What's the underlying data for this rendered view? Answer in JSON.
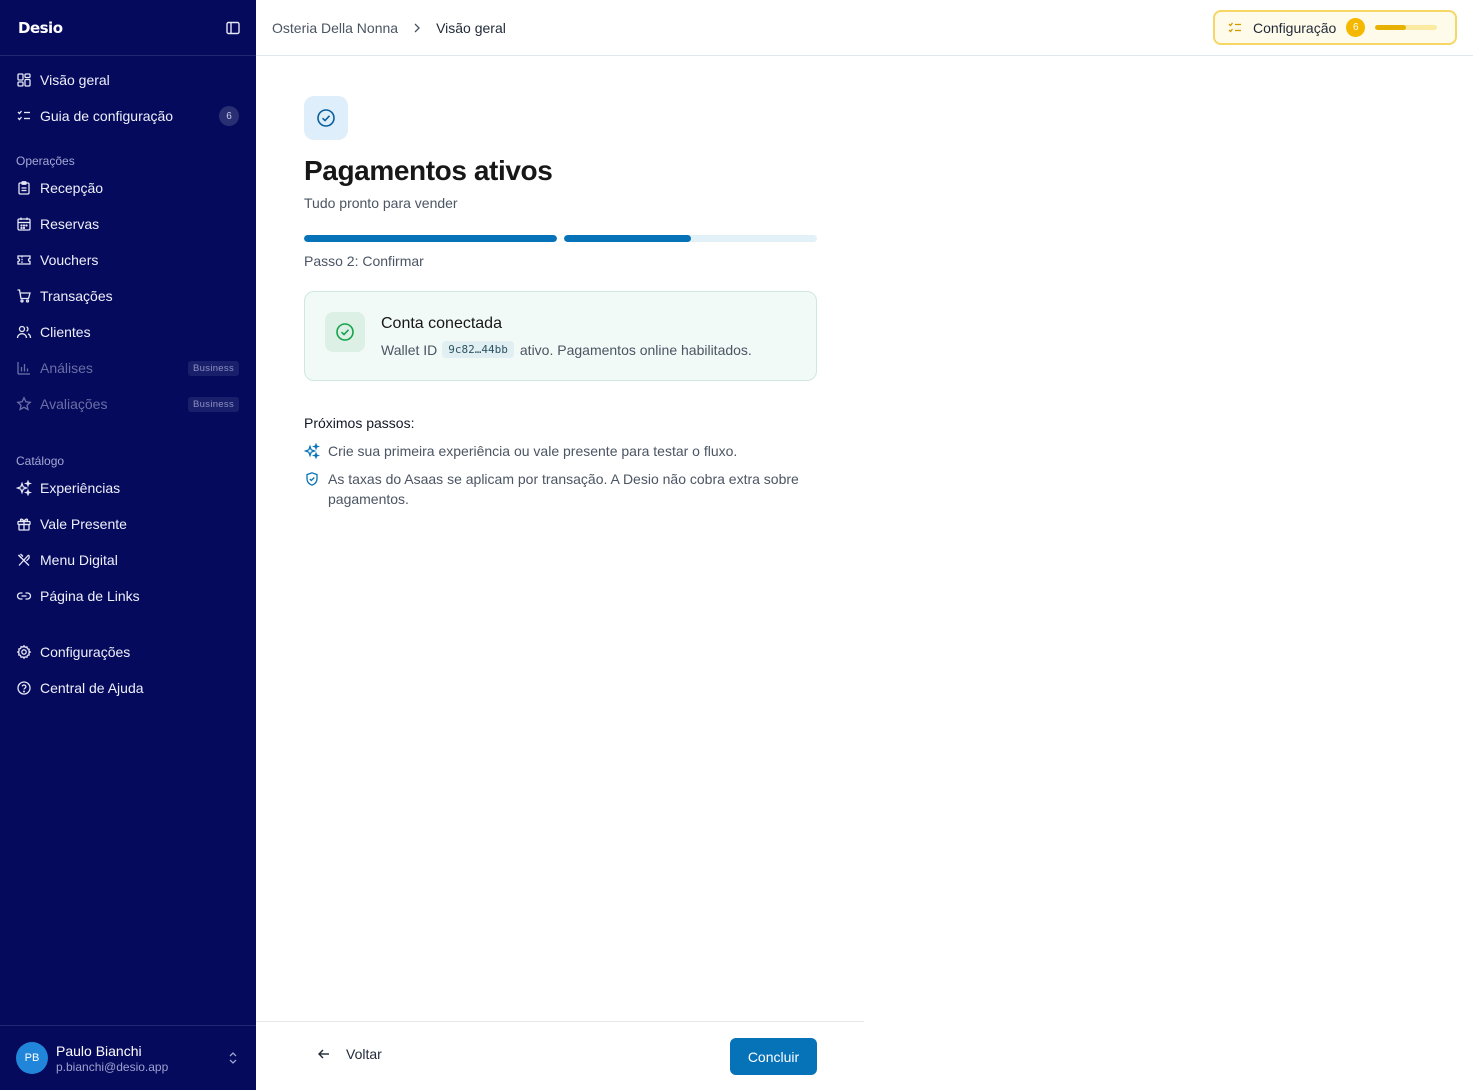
{
  "app": {
    "logo": "Desio"
  },
  "sidebar": {
    "items_top": [
      {
        "label": "Visão geral",
        "icon": "layout-grid-icon"
      },
      {
        "label": "Guia de configuração",
        "icon": "list-checks-icon",
        "badge": "6"
      }
    ],
    "operations": {
      "title": "Operações",
      "items": [
        {
          "label": "Recepção",
          "icon": "clipboard-icon"
        },
        {
          "label": "Reservas",
          "icon": "calendar-icon"
        },
        {
          "label": "Vouchers",
          "icon": "ticket-icon"
        },
        {
          "label": "Transações",
          "icon": "cart-icon"
        },
        {
          "label": "Clientes",
          "icon": "users-icon"
        },
        {
          "label": "Análises",
          "icon": "bar-chart-icon",
          "tag": "Business",
          "disabled": true
        },
        {
          "label": "Avaliações",
          "icon": "star-icon",
          "tag": "Business",
          "disabled": true
        }
      ]
    },
    "catalog": {
      "title": "Catálogo",
      "items": [
        {
          "label": "Experiências",
          "icon": "sparkles-icon"
        },
        {
          "label": "Vale Presente",
          "icon": "gift-icon"
        },
        {
          "label": "Menu Digital",
          "icon": "utensils-icon"
        },
        {
          "label": "Página de Links",
          "icon": "link-icon"
        }
      ]
    },
    "bottom": [
      {
        "label": "Configurações",
        "icon": "gear-icon"
      },
      {
        "label": "Central de Ajuda",
        "icon": "help-circle-icon"
      }
    ],
    "user": {
      "initials": "PB",
      "name": "Paulo Bianchi",
      "email": "p.bianchi@desio.app"
    }
  },
  "header": {
    "breadcrumb": [
      "Osteria Della Nonna",
      "Visão geral"
    ],
    "setup": {
      "label": "Configuração",
      "count": "6",
      "progress": 0.5
    }
  },
  "main": {
    "title": "Pagamentos ativos",
    "subtitle": "Tudo pronto para vender",
    "steps_progress": [
      1.0,
      0.5
    ],
    "step_caption": "Passo 2: Confirmar",
    "card": {
      "title": "Conta conectada",
      "prefix": "Wallet ID",
      "wallet_id": "9c82…44bb",
      "suffix": "ativo. Pagamentos online habilitados."
    },
    "next_title": "Próximos passos:",
    "next_items": [
      {
        "icon": "sparkles-icon",
        "text": "Crie sua primeira experiência ou vale presente para testar o fluxo."
      },
      {
        "icon": "shield-check-icon",
        "text": "As taxas do Asaas se aplicam por transação. A Desio não cobra extra sobre pagamentos."
      }
    ]
  },
  "footer": {
    "back_label": "Voltar",
    "primary_label": "Concluir"
  },
  "colors": {
    "sidebar_bg": "#050a5c",
    "primary": "#0672b8",
    "setup_accent": "#f5b800",
    "success": "#16a34a"
  }
}
